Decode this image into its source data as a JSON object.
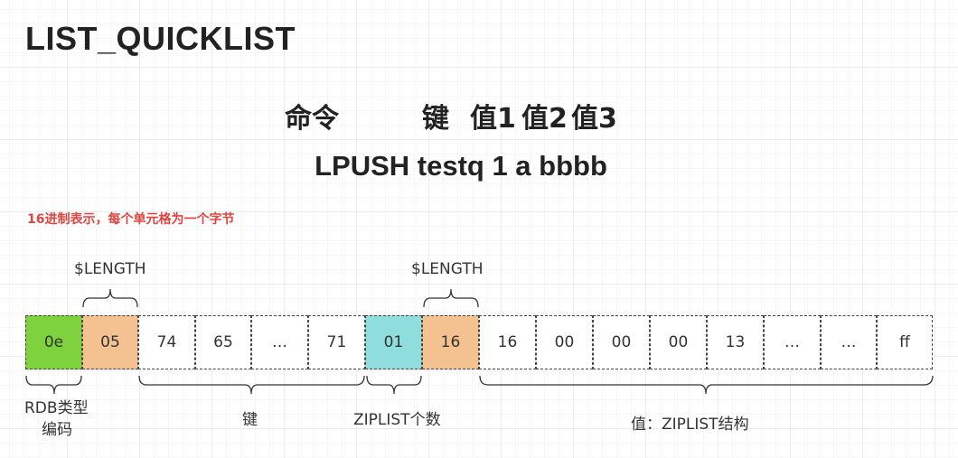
{
  "title": "LIST_QUICKLIST",
  "command_header": {
    "cmd": "命令",
    "key": "键",
    "v1": "值1",
    "v2": "值2",
    "v3": "值3"
  },
  "command_line": "LPUSH testq 1 a bbbb",
  "note": "16进制表示，每个单元格为一个字节",
  "cells": [
    "0e",
    "05",
    "74",
    "65",
    "…",
    "71",
    "01",
    "16",
    "16",
    "00",
    "00",
    "00",
    "13",
    "…",
    "…",
    "ff"
  ],
  "colors": {
    "type": "#7ed23e",
    "length": "#f4c190",
    "count": "#8fdedd",
    "note": "#e0443e"
  },
  "labels": {
    "length_1": "$LENGTH",
    "length_2": "$LENGTH",
    "rdb_type_1": "RDB类型",
    "rdb_type_2": "编码",
    "key": "键",
    "ziplist_count": "ZIPLIST个数",
    "value_struct": "值：ZIPLIST结构"
  }
}
